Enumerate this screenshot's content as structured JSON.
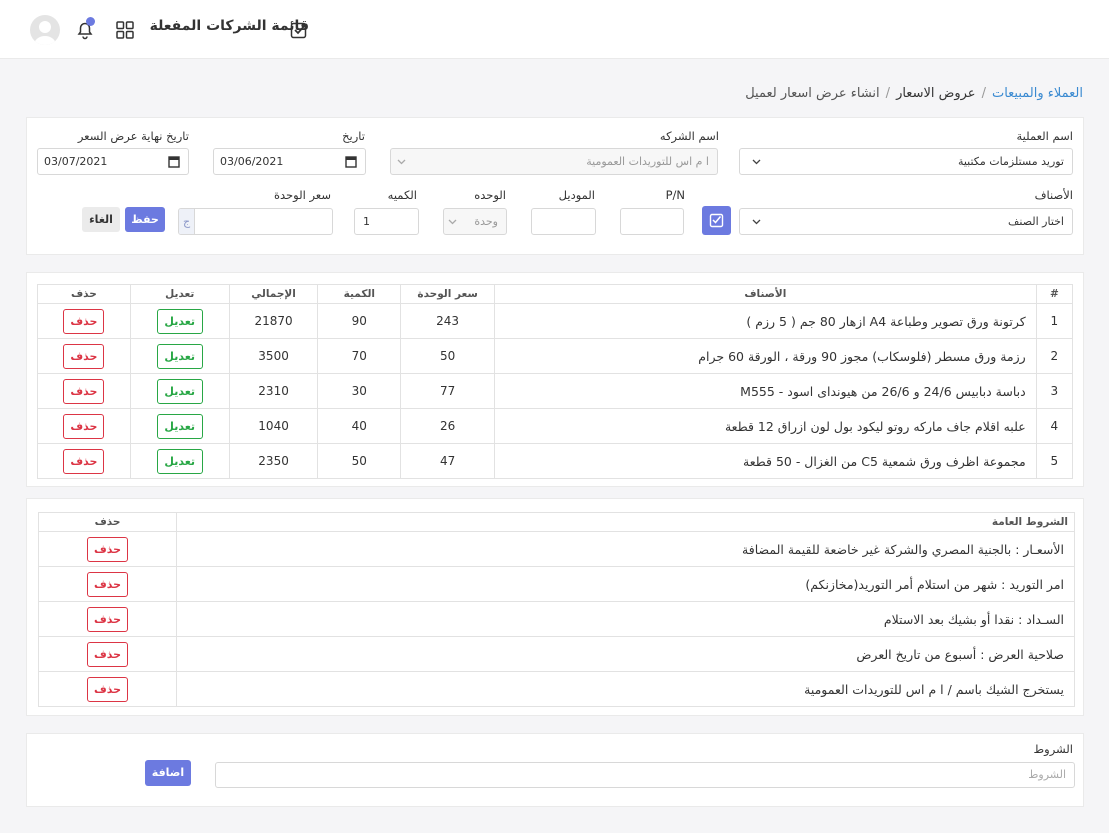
{
  "topbar": {
    "title": "قائمة الشركات المفعلة",
    "icons": [
      "check-square-icon",
      "apps-grid-icon",
      "bell-icon",
      "avatar"
    ]
  },
  "breadcrumb": {
    "root": "العملاء والمبيعات",
    "parent": "عروض الاسعار",
    "current": "انشاء عرض اسعار لعميل"
  },
  "form": {
    "operation_label": "اسم العملية",
    "operation_value": "توريد مستلزمات مكتبية",
    "company_label": "اسم الشركه",
    "company_value": "ا م اس للتوريدات العمومية",
    "date_label": "تاريخ",
    "date_value": "03/06/2021",
    "end_date_label": "تاريخ نهاية عرض السعر",
    "end_date_value": "03/07/2021",
    "items_label": "الأصناف",
    "items_placeholder": "اختار الصنف",
    "pn_label": "P/N",
    "pn_value": "",
    "model_label": "الموديل",
    "model_value": "",
    "unit_label": "الوحده",
    "unit_value": "وحدة",
    "qty_label": "الكميه",
    "qty_value": "1",
    "unit_price_label": "سعر الوحدة",
    "unit_price_value": "",
    "currency_symbol": "ج",
    "save_label": "حفظ",
    "cancel_label": "الغاء"
  },
  "items_table": {
    "headers": [
      "#",
      "الأصناف",
      "سعر الوحدة",
      "الكمية",
      "الإجمالي",
      "تعديل",
      "حذف"
    ],
    "rows": [
      {
        "num": "1",
        "name": "كرتونة ورق تصوير وطباعة A4 ازهار 80 جم ( 5 رزم )",
        "price": "243",
        "qty": "90",
        "total": "21870",
        "edit": "تعديل",
        "del": "حذف"
      },
      {
        "num": "2",
        "name": "رزمة ورق مسطر (فلوسكاب) مجوز 90 ورقة ، الورقة 60 جرام",
        "price": "50",
        "qty": "70",
        "total": "3500",
        "edit": "تعديل",
        "del": "حذف"
      },
      {
        "num": "3",
        "name": "دباسة دبابيس 24/6 و 26/6 من هيونداى اسود - M555",
        "price": "77",
        "qty": "30",
        "total": "2310",
        "edit": "تعديل",
        "del": "حذف"
      },
      {
        "num": "4",
        "name": "علبه اقلام جاف ماركه روتو ليكود بول لون ازراق 12 قطعة",
        "price": "26",
        "qty": "40",
        "total": "1040",
        "edit": "تعديل",
        "del": "حذف"
      },
      {
        "num": "5",
        "name": "مجموعة اظرف ورق شمعية C5 من الغزال - 50 قطعة",
        "price": "47",
        "qty": "50",
        "total": "2350",
        "edit": "تعديل",
        "del": "حذف"
      }
    ]
  },
  "terms_table": {
    "headers": [
      "الشروط العامة",
      "حذف"
    ],
    "rows": [
      {
        "text": "الأسعـار : بالجنية المصري والشركة غير خاضعة للقيمة المضافة",
        "del": "حذف"
      },
      {
        "text": "امر التوريد : شهر من استلام أمر التوريد(مخازنكم)",
        "del": "حذف"
      },
      {
        "text": "السـداد : نقدا أو بشيك بعد الاستلام",
        "del": "حذف"
      },
      {
        "text": "صلاحية العرض : أسبوع من تاريخ العرض",
        "del": "حذف"
      },
      {
        "text": "يستخرج الشيك باسم / ا م اس للتوريدات العمومية",
        "del": "حذف"
      }
    ]
  },
  "add_terms": {
    "label": "الشروط",
    "placeholder": "الشروط",
    "button": "اضافة"
  },
  "colors": {
    "primary": "#6c7ae0",
    "edit": "#28a745",
    "delete": "#dc3545",
    "link": "#3a8ad1"
  }
}
